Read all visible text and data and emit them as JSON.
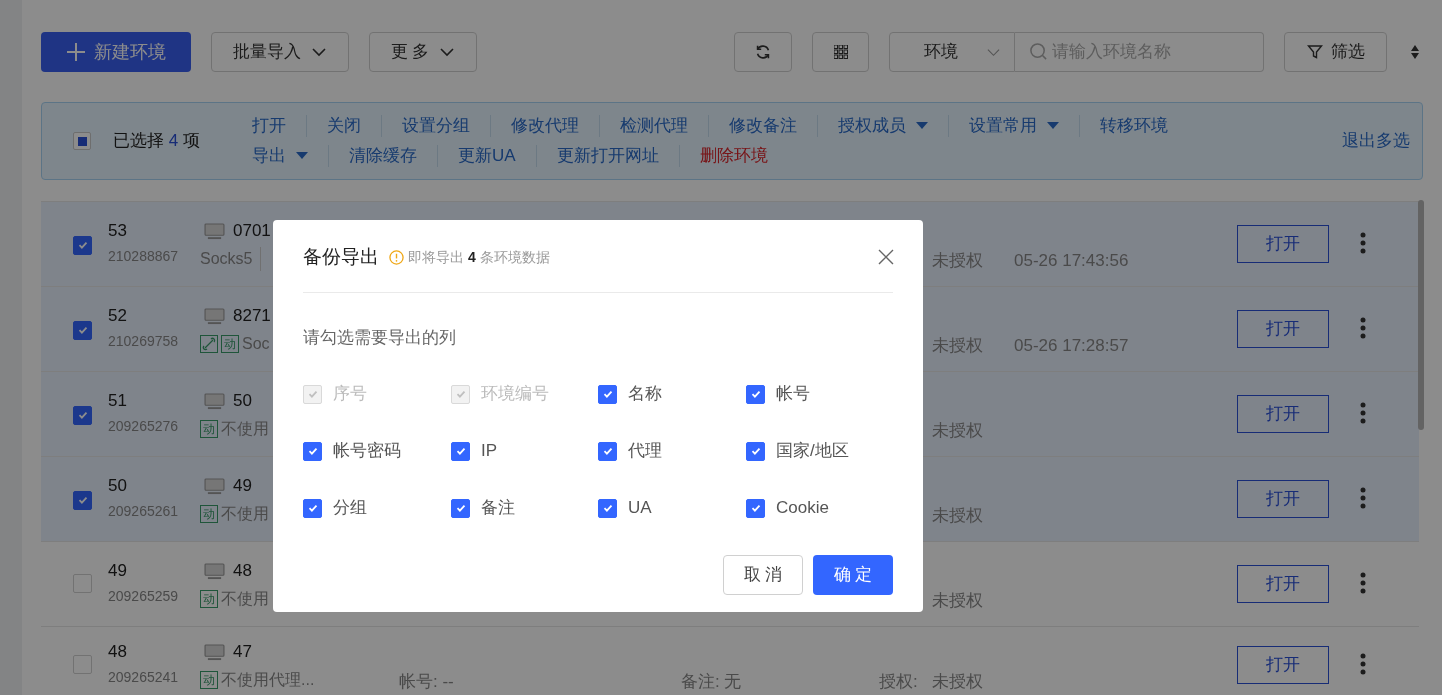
{
  "toolbar": {
    "new_button": "新建环境",
    "import_button": "批量导入",
    "more_button": "更 多",
    "search_scope": "环境",
    "search": {
      "placeholder": "请输入环境名称"
    },
    "filter_button": "筛选"
  },
  "selection_bar": {
    "indeterminate": true,
    "prefix": "已选择",
    "count": "4",
    "suffix": "项",
    "exit": "退出多选",
    "actions": [
      [
        {
          "label": "打开",
          "dropdown": false,
          "danger": false
        },
        {
          "label": "关闭",
          "dropdown": false,
          "danger": false
        },
        {
          "label": "设置分组",
          "dropdown": false,
          "danger": false
        },
        {
          "label": "修改代理",
          "dropdown": false,
          "danger": false
        },
        {
          "label": "检测代理",
          "dropdown": false,
          "danger": false
        },
        {
          "label": "修改备注",
          "dropdown": false,
          "danger": false
        },
        {
          "label": "授权成员",
          "dropdown": true,
          "danger": false
        },
        {
          "label": "设置常用",
          "dropdown": true,
          "danger": false
        },
        {
          "label": "转移环境",
          "dropdown": false,
          "danger": false
        }
      ],
      [
        {
          "label": "导出",
          "dropdown": true,
          "danger": false
        },
        {
          "label": "清除缓存",
          "dropdown": false,
          "danger": false
        },
        {
          "label": "更新UA",
          "dropdown": false,
          "danger": false
        },
        {
          "label": "更新打开网址",
          "dropdown": false,
          "danger": false
        },
        {
          "label": "删除环境",
          "dropdown": false,
          "danger": true
        }
      ]
    ]
  },
  "rows": [
    {
      "selected": true,
      "number": "53",
      "id": "210288867",
      "name": "0701",
      "tags": [],
      "proxy": "Socks5",
      "separator": true,
      "auth": "未授权",
      "time": "05-26 17:43:56",
      "open": "打开"
    },
    {
      "selected": true,
      "number": "52",
      "id": "210269758",
      "name": "8271",
      "tags": [
        {
          "kind": "link"
        },
        {
          "kind": "text",
          "text": "动"
        }
      ],
      "proxy": "Soc",
      "separator": false,
      "auth": "未授权",
      "time": "05-26 17:28:57",
      "open": "打开"
    },
    {
      "selected": true,
      "number": "51",
      "id": "209265276",
      "name": "50",
      "tags": [
        {
          "kind": "text",
          "text": "动"
        }
      ],
      "proxy": "不使用",
      "separator": false,
      "auth": "未授权",
      "open": "打开"
    },
    {
      "selected": true,
      "number": "50",
      "id": "209265261",
      "name": "49",
      "tags": [
        {
          "kind": "text",
          "text": "动"
        }
      ],
      "proxy": "不使用",
      "separator": false,
      "auth": "未授权",
      "open": "打开"
    },
    {
      "selected": false,
      "number": "49",
      "id": "209265259",
      "name": "48",
      "tags": [
        {
          "kind": "text",
          "text": "动"
        }
      ],
      "proxy": "不使用",
      "separator": false,
      "auth": "未授权",
      "open": "打开"
    },
    {
      "selected": false,
      "number": "48",
      "id": "209265241",
      "name": "47",
      "tags": [
        {
          "kind": "text",
          "text": "动"
        }
      ],
      "proxy": "不使用代理...",
      "separator": false,
      "account": "帐号: --",
      "remark": "备注: 无",
      "auth_label": "授权:",
      "auth": "未授权",
      "open": "打开"
    }
  ],
  "dialog": {
    "title": "备份导出",
    "note": "即将导出 **4** 条环境数据",
    "subtitle": "请勾选需要导出的列",
    "options": [
      {
        "label": "序号",
        "checked": true,
        "disabled": true
      },
      {
        "label": "环境编号",
        "checked": true,
        "disabled": true
      },
      {
        "label": "名称",
        "checked": true,
        "disabled": false
      },
      {
        "label": "帐号",
        "checked": true,
        "disabled": false
      },
      {
        "label": "帐号密码",
        "checked": true,
        "disabled": false
      },
      {
        "label": "IP",
        "checked": true,
        "disabled": false
      },
      {
        "label": "代理",
        "checked": true,
        "disabled": false
      },
      {
        "label": "国家/地区",
        "checked": true,
        "disabled": false
      },
      {
        "label": "分组",
        "checked": true,
        "disabled": false
      },
      {
        "label": "备注",
        "checked": true,
        "disabled": false
      },
      {
        "label": "UA",
        "checked": true,
        "disabled": false
      },
      {
        "label": "Cookie",
        "checked": true,
        "disabled": false
      }
    ],
    "cancel": "取 消",
    "confirm": "确 定"
  }
}
